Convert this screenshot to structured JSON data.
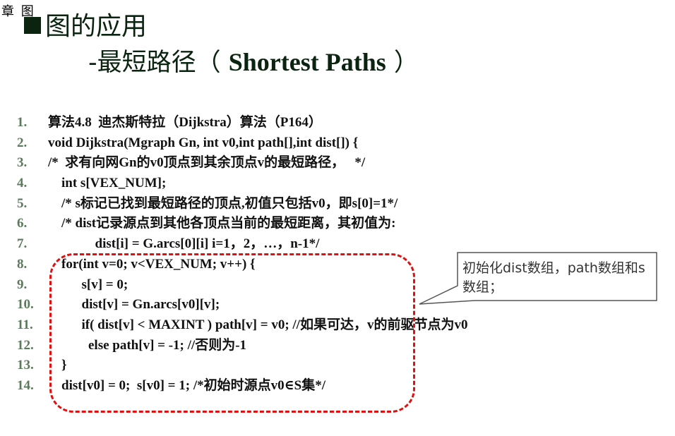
{
  "header": {
    "chapter_mark": "章 图",
    "title_line1": "图的应用",
    "title_line2_prefix": "-最短路径（ ",
    "title_line2_en": "Shortest Paths",
    "title_line2_suffix": " ）"
  },
  "code": [
    {
      "num": "1.",
      "text": "算法4.8  迪杰斯特拉（Dijkstra）算法（P164）"
    },
    {
      "num": "2.",
      "text": "void Dijkstra(Mgraph Gn, int v0,int path[],int dist[]) {"
    },
    {
      "num": "3.",
      "text": "/*  求有向网Gn的v0顶点到其余顶点v的最短路径，   */"
    },
    {
      "num": "4.",
      "text": "    int s[VEX_NUM];"
    },
    {
      "num": "5.",
      "text": "    /* s标记已找到最短路径的顶点,初值只包括v0，即s[0]=1*/"
    },
    {
      "num": "6.",
      "text": "    /* dist记录源点到其他各顶点当前的最短距离，其初值为:"
    },
    {
      "num": "7.",
      "text": "              dist[i] = G.arcs[0][i] i=1，2，…，n-1*/"
    },
    {
      "num": "8.",
      "text": "    for(int v=0; v<VEX_NUM; v++) {"
    },
    {
      "num": "9.",
      "text": "          s[v] = 0;"
    },
    {
      "num": "10.",
      "text": "          dist[v] = Gn.arcs[v0][v];"
    },
    {
      "num": "11.",
      "text": "          if( dist[v] < MAXINT ) path[v] = v0; //如果可达，v的前驱节点为v0"
    },
    {
      "num": "12.",
      "text": "            else path[v] = -1; //否则为-1"
    },
    {
      "num": "13.",
      "text": "    }"
    },
    {
      "num": "14.",
      "text": "    dist[v0] = 0;  s[v0] = 1; /*初始时源点v0∈S集*/"
    }
  ],
  "callout": {
    "text": "初始化dist数组，path数组和s数组；"
  },
  "colors": {
    "title": "#0b2410",
    "line_number": "#5b7a5b",
    "dashed_border": "#e01010",
    "callout_border": "#555555"
  }
}
